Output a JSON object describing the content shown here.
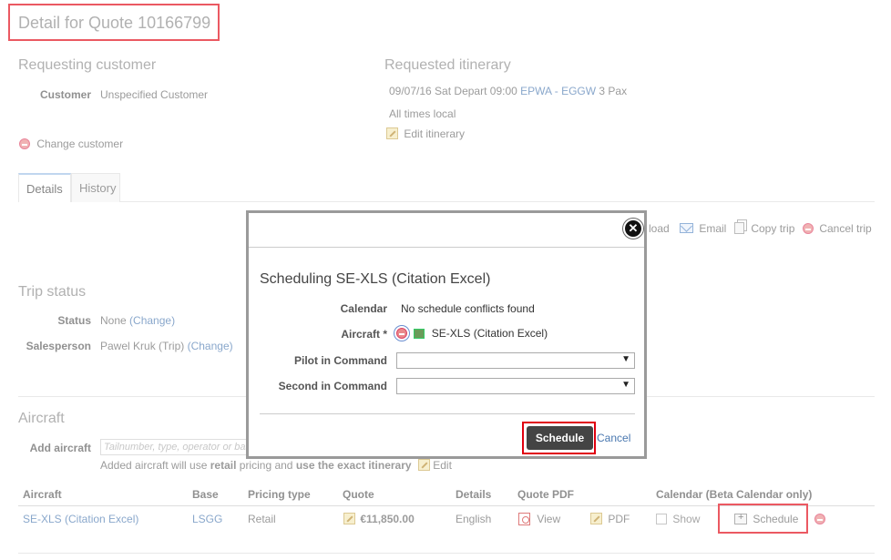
{
  "page": {
    "title": "Detail for Quote 10166799"
  },
  "customer": {
    "section_title": "Requesting customer",
    "label": "Customer",
    "value": "Unspecified Customer",
    "change_label": "Change customer"
  },
  "itinerary": {
    "section_title": "Requested itinerary",
    "date": "09/07/16 Sat",
    "depart_label": "Depart",
    "time": "09:00",
    "from": "EPWA",
    "separator": "-",
    "to": "EGGW",
    "pax": "3 Pax",
    "times_note": "All times local",
    "edit_label": "Edit itinerary"
  },
  "tabs": [
    {
      "label": "Details"
    },
    {
      "label": "History"
    }
  ],
  "actions": {
    "download_partial": "load",
    "email": "Email",
    "copy": "Copy trip",
    "cancel": "Cancel trip"
  },
  "trip_status": {
    "section_title": "Trip status",
    "status_label": "Status",
    "status_value": "None",
    "status_change": "(Change)",
    "salesperson_label": "Salesperson",
    "salesperson_value": "Pawel Kruk (Trip)",
    "salesperson_change": "(Change)"
  },
  "aircraft": {
    "section_title": "Aircraft",
    "add_label": "Add aircraft",
    "add_placeholder": "Tailnumber, type, operator or base",
    "note_prefix": "Added aircraft will use",
    "note_bold1": "retail",
    "note_mid": "pricing and",
    "note_bold2": "use the exact itinerary",
    "note_edit": "Edit",
    "columns": [
      "Aircraft",
      "Base",
      "Pricing type",
      "Quote",
      "Details",
      "Quote PDF",
      "Calendar (Beta Calendar only)"
    ],
    "row": {
      "aircraft": "SE-XLS (Citation Excel)",
      "base": "LSGG",
      "pricing": "Retail",
      "quote": "€11,850.00",
      "details": "English",
      "view": "View",
      "pdf": "PDF",
      "show": "Show",
      "schedule": "Schedule"
    }
  },
  "modal": {
    "title": "Scheduling SE-XLS (Citation Excel)",
    "calendar_label": "Calendar",
    "calendar_value": "No schedule conflicts found",
    "aircraft_label": "Aircraft *",
    "aircraft_value": "SE-XLS (Citation Excel)",
    "pic_label": "Pilot in Command",
    "sic_label": "Second in Command",
    "schedule_button": "Schedule",
    "cancel_link": "Cancel",
    "close_glyph": "✕"
  },
  "colors": {
    "highlight": "#e0000f",
    "link": "#4a78b0",
    "dark_button": "#444444"
  }
}
